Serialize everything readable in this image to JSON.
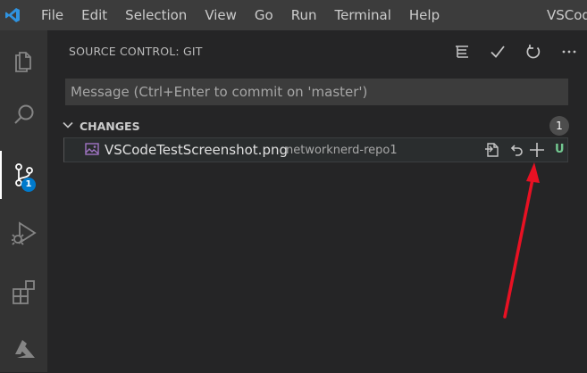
{
  "titlebar": {
    "menu": [
      "File",
      "Edit",
      "Selection",
      "View",
      "Go",
      "Run",
      "Terminal",
      "Help"
    ],
    "window_title": "VSCode"
  },
  "activitybar": {
    "icons": [
      "files-icon",
      "search-icon",
      "source-control-icon",
      "run-debug-icon",
      "extensions-icon",
      "azure-icon"
    ],
    "scm_badge": "1"
  },
  "sidebar": {
    "title": "SOURCE CONTROL: GIT",
    "commit_placeholder": "Message (Ctrl+Enter to commit on 'master')",
    "commit_value": "",
    "changes": {
      "label": "CHANGES",
      "count": "1",
      "files": [
        {
          "name": "VSCodeTestScreenshot.png",
          "folder": "networknerd-repo1",
          "status": "U"
        }
      ]
    }
  },
  "colors": {
    "accent": "#007acc",
    "untracked": "#73c991",
    "annotation_arrow": "#e81123",
    "file_icon": "#a074c4"
  }
}
